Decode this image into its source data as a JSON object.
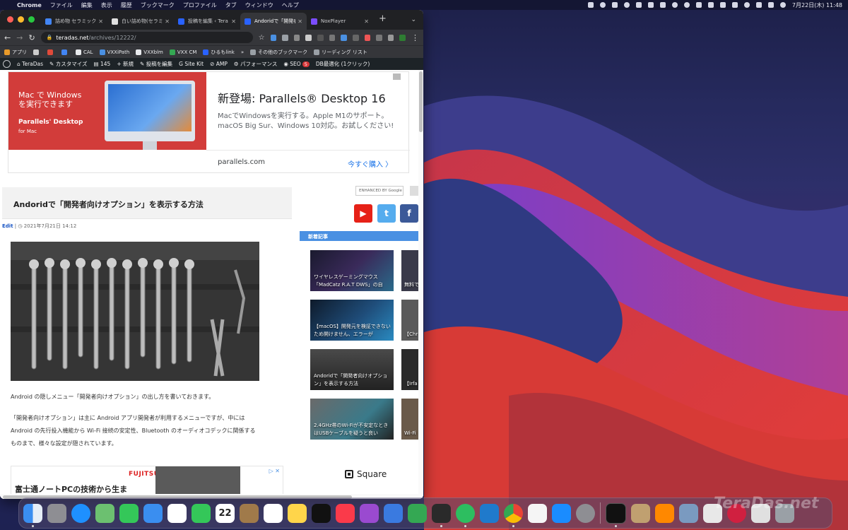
{
  "menubar": {
    "app": "Chrome",
    "items": [
      "ファイル",
      "編集",
      "表示",
      "履歴",
      "ブックマーク",
      "プロファイル",
      "タブ",
      "ウィンドウ",
      "ヘルプ"
    ],
    "clock": "7月22日(木) 11:48"
  },
  "tabs": [
    {
      "title": "詰め物 セラミック",
      "color": "#4285f4"
    },
    {
      "title": "白い詰め物(セラミ",
      "color": "#e0e0e0"
    },
    {
      "title": "投稿を編集 ‹ Tera",
      "color": "#2962ff"
    },
    {
      "title": "Andoridで「開発者",
      "color": "#2962ff",
      "active": true
    },
    {
      "title": "NoxPlayer",
      "color": "#7b4dff"
    }
  ],
  "toolbar": {
    "url_host": "teradas.net",
    "url_path": "/archives/12222/"
  },
  "bookmarks": [
    "アプリ",
    "",
    "",
    "",
    "CAL",
    "VXXiPath",
    "VXXblm",
    "VXX CM",
    "ひるもlink",
    "»",
    "その他のブックマーク",
    "リーディング リスト"
  ],
  "wpbar": {
    "site": "TeraDas",
    "customize": "カスタマイズ",
    "comments": "145",
    "new": "新規",
    "edit_post": "投稿を編集",
    "sitekit": "Site Kit",
    "amp": "AMP",
    "performance": "パフォーマンス",
    "seo": "SEO",
    "seo_badge": "5",
    "db": "DB最適化 (1クリック)"
  },
  "ad": {
    "headline": "Mac で Windows を実行できます",
    "headline_line2": "を実行できます",
    "headline_line1": "Mac で Windows",
    "product": "Parallels' Desktop",
    "platform": "for Mac",
    "title": "新登場: Parallels® Desktop 16",
    "desc": "MacでWindowsを実行する。Apple M1のサポート。macOS Big Sur、Windows 10対応。お試しください!",
    "domain": "parallels.com",
    "cta": "今すぐ購入 〉"
  },
  "post": {
    "title": "Andoridで「開発者向けオプション」を表示する方法",
    "edit": "Edit",
    "date": "| ◷ 2021年7月21日 14:12",
    "p1": "Android の隠しメニュー「開発者向けオプション」の出し方を書いておきます。",
    "p2a": "「開発者向けオプション」は主に Android アプリ開発者が利用するメニューですが、中には",
    "p2b": "Android の先行投入機能から Wi-Fi 接続の安定性、Bluetooth のオーディオコデックに関係する",
    "p2c": "ものまで、様々な設定が隠されています。"
  },
  "ad2": {
    "text": "富士通ノートPCの技術から生ま",
    "brand": "FUJITSU"
  },
  "sidebar": {
    "search_placeholder": "ENHANCED BY Google",
    "social": [
      "▶",
      "t",
      "f"
    ],
    "new_header": "新着記事",
    "cards": [
      "ワイヤレスゲーミングマウス「MadCatz R.A.T DWS」の自",
      "【macOS】開発元を検証できないため開けません、エラーが",
      "Andoridで「開発者向けオプション」を表示する方法",
      "2.4GHz帯のWi-Fiが不安定なときはUSBケーブルを疑うと良い"
    ],
    "cards_right": [
      "無料で…\n犠牲を",
      "【Chr\nされる",
      "【Irfa\n変で",
      "Wi-Fi\nトプ"
    ],
    "square": "Square"
  },
  "dock": {
    "calendar_day": "22",
    "items": [
      "finder-icon",
      "launchpad-icon",
      "safari-icon",
      "maps-icon",
      "messages-icon",
      "mail-icon",
      "photos-icon",
      "facetime-icon",
      "calendar-icon",
      "contacts-icon",
      "reminders-icon",
      "notes-icon",
      "tv-icon",
      "music-icon",
      "podcasts-icon",
      "keynote-icon",
      "numbers-icon",
      "davinci-icon",
      "evernote-icon",
      "vscode-icon",
      "chrome-icon",
      "textedit-icon",
      "appstore-icon",
      "settings-icon",
      "terminal-icon",
      "affinity-icon",
      "vlc-icon",
      "preview-icon",
      "script-icon",
      "lips-icon",
      "archive-icon",
      "trash-icon"
    ]
  },
  "watermark": "TeraDas.net",
  "colors": {
    "accent": "#4a90e2",
    "menubar": "#141633",
    "chrome_dark": "#202124"
  }
}
